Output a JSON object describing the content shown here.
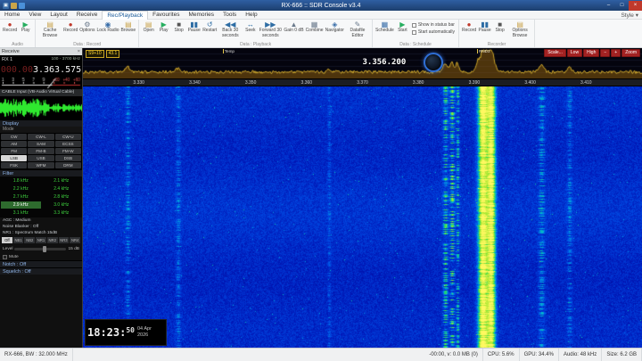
{
  "window": {
    "title": "RX-666 :: SDR Console v3.4",
    "controls": {
      "minimize": "–",
      "maximize": "□",
      "close": "×"
    },
    "app_glyph": "▣"
  },
  "menu": {
    "tabs": [
      "Home",
      "View",
      "Layout",
      "Receive",
      "Rec/Playback",
      "Favourites",
      "Memories",
      "Tools",
      "Help"
    ],
    "active_tab": "Rec/Playback",
    "style_label": "Style ▾"
  },
  "ribbon": {
    "groups": [
      {
        "label": "Audio",
        "buttons": [
          {
            "label": "Record",
            "icon": "record-icon",
            "glyph": "●",
            "color": "#c0392b"
          },
          {
            "label": "Play",
            "icon": "play-icon",
            "glyph": "▶",
            "color": "#27ae60"
          }
        ]
      },
      {
        "label": "Data : Record",
        "buttons": [
          {
            "label": "Cache Browse",
            "icon": "folder-icon",
            "glyph": "▤",
            "color": "#c8a24a"
          },
          {
            "label": "Record",
            "icon": "record-icon",
            "glyph": "●",
            "color": "#c0392b"
          },
          {
            "label": "Options",
            "icon": "gear-icon",
            "glyph": "⚙",
            "color": "#6b7a8c"
          },
          {
            "label": "Lock Radio",
            "icon": "lock-icon",
            "glyph": "◉",
            "color": "#3a6ea8"
          },
          {
            "label": "Browse",
            "icon": "folder-icon",
            "glyph": "▤",
            "color": "#c8a24a"
          }
        ]
      },
      {
        "label": "Data : Playback",
        "buttons": [
          {
            "label": "Open",
            "icon": "open-folder-icon",
            "glyph": "▤",
            "color": "#c8a24a"
          },
          {
            "label": "Play",
            "icon": "play-icon",
            "glyph": "▶",
            "color": "#27ae60"
          },
          {
            "label": "Stop",
            "icon": "stop-icon",
            "glyph": "■",
            "color": "#555"
          },
          {
            "label": "Pause",
            "icon": "pause-icon",
            "glyph": "▮▮",
            "color": "#2e6da4"
          },
          {
            "label": "Restart",
            "icon": "restart-icon",
            "glyph": "↺",
            "color": "#2e6da4"
          },
          {
            "label": "Back 30 seconds",
            "icon": "rewind-icon",
            "glyph": "◀◀",
            "color": "#2e6da4"
          },
          {
            "label": "Seek",
            "icon": "seek-icon",
            "glyph": "↔",
            "color": "#2e6da4"
          },
          {
            "label": "Forward 30 seconds",
            "icon": "forward-icon",
            "glyph": "▶▶",
            "color": "#2e6da4"
          },
          {
            "label": "Gain 0 dB",
            "icon": "gain-icon",
            "glyph": "▲",
            "color": "#6b7a8c"
          },
          {
            "label": "Combine",
            "icon": "combine-icon",
            "glyph": "▦",
            "color": "#6b7a8c"
          },
          {
            "label": "Navigator",
            "icon": "navigator-icon",
            "glyph": "◈",
            "color": "#3a6ea8"
          },
          {
            "label": "Datafile Editor",
            "icon": "editor-icon",
            "glyph": "✎",
            "color": "#6b7a8c"
          }
        ]
      },
      {
        "label": "Data : Schedule",
        "buttons": [
          {
            "label": "Schedule",
            "icon": "schedule-icon",
            "glyph": "▦",
            "color": "#3a6ea8"
          },
          {
            "label": "Start",
            "icon": "start-icon",
            "glyph": "▶",
            "color": "#27ae60"
          }
        ],
        "checks": [
          "Show in status bar",
          "Start automatically"
        ]
      },
      {
        "label": "Recorder",
        "buttons": [
          {
            "label": "Record",
            "icon": "record-icon",
            "glyph": "●",
            "color": "#c0392b"
          },
          {
            "label": "Pause",
            "icon": "pause-icon",
            "glyph": "▮▮",
            "color": "#2e6da4"
          },
          {
            "label": "Stop",
            "icon": "stop-icon",
            "glyph": "■",
            "color": "#555"
          },
          {
            "label": "Options Browse",
            "icon": "folder-icon",
            "glyph": "▤",
            "color": "#c8a24a"
          }
        ]
      }
    ]
  },
  "receiver": {
    "panel_title": "Receive",
    "close_glyph": "×",
    "rx_label": "RX 1",
    "range": "100 - 3700 kHz",
    "freq_dim": "000.00",
    "freq_main": "3.363.575",
    "audio_device": "CABLE Input (VB-Audio Virtual Cable)"
  },
  "display_section": {
    "title": "Display",
    "mode_label": "Mode",
    "modes": [
      "CW",
      "CW-L",
      "CW-U",
      "AM",
      "SAM",
      "ECSS",
      "FM",
      "FM-B",
      "FM-W",
      "LSB",
      "USB",
      "DSB",
      "FSK",
      "WFM",
      "DRM"
    ],
    "active_mode": "LSB"
  },
  "filter_section": {
    "title": "Filter",
    "bandwidths": [
      "1.8 kHz",
      "2.1 kHz",
      "2.2 kHz",
      "2.4 kHz",
      "2.7 kHz",
      "2.8 kHz",
      "2.9 kHz",
      "3.0 kHz",
      "3.1 kHz",
      "3.3 kHz"
    ],
    "active": "2.9 kHz"
  },
  "radio_section": {
    "lines": [
      "AGC : Medium",
      "Noise Blanker : Off",
      "NR1 : Spectrum Match 15dB"
    ],
    "nr_buttons": [
      "Off",
      "NB1",
      "NB2",
      "NR1",
      "NR2",
      "NR3",
      "NR4"
    ],
    "active_nr": "Off",
    "level_label": "Level",
    "level_value": "15 dB",
    "mute_label": "Mute",
    "notch_label": "Notch : Off",
    "squelch_label": "Squelch : Off"
  },
  "spectrum": {
    "meter_badges": [
      "S9+10",
      "43.1"
    ],
    "freq_readout": "3.356.200",
    "markers": [
      {
        "label": "Temp",
        "frac": 0.25
      },
      {
        "label": "RND3",
        "frac": 0.705
      }
    ],
    "buttons": [
      "Scale...",
      "Low",
      "High",
      "−",
      "+",
      "Zoom"
    ]
  },
  "ruler": {
    "ticks": [
      "3.330",
      "3.340",
      "3.350",
      "3.360",
      "3.370",
      "3.380",
      "3.390",
      "3.400",
      "3.410"
    ]
  },
  "waterfall": {
    "signals": [
      {
        "f": 0.715,
        "amp": 1.0,
        "w": 0.006,
        "burst": false
      },
      {
        "f": 0.73,
        "amp": 0.95,
        "w": 0.005,
        "burst": false
      },
      {
        "f": 0.648,
        "amp": 0.45,
        "w": 0.003,
        "burst": true
      },
      {
        "f": 0.66,
        "amp": 0.5,
        "w": 0.003,
        "burst": true
      },
      {
        "f": 0.67,
        "amp": 0.4,
        "w": 0.002,
        "burst": true
      },
      {
        "f": 0.08,
        "amp": 0.22,
        "w": 0.003,
        "burst": true
      },
      {
        "f": 0.17,
        "amp": 0.2,
        "w": 0.003,
        "burst": true
      },
      {
        "f": 0.44,
        "amp": 0.16,
        "w": 0.002,
        "burst": true
      },
      {
        "f": 0.82,
        "amp": 0.28,
        "w": 0.004,
        "burst": true
      },
      {
        "f": 0.87,
        "amp": 0.2,
        "w": 0.003,
        "burst": true
      }
    ]
  },
  "clock": {
    "time_prefix": "18:23:",
    "time_seconds": "50",
    "date_day": "04 Apr",
    "date_year": "2026"
  },
  "status_bar": {
    "left": "RX-666, BW : 32.000 MHz",
    "items": [
      "-00:00, v: 0.0 MB (0)",
      "CPU: 5.6%",
      "GPU: 34.4%",
      "Audio: 48 kHz",
      "Size: 6.2 GB"
    ]
  }
}
